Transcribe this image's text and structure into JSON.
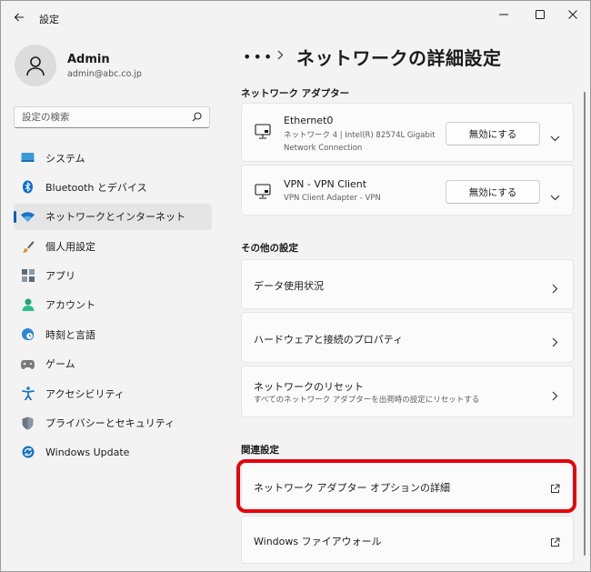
{
  "window": {
    "title": "設定"
  },
  "profile": {
    "name": "Admin",
    "email": "admin@abc.co.jp"
  },
  "search": {
    "placeholder": "設定の検索"
  },
  "sidebar": {
    "items": [
      {
        "label": "システム",
        "icon": "monitor-icon"
      },
      {
        "label": "Bluetooth とデバイス",
        "icon": "bluetooth-icon"
      },
      {
        "label": "ネットワークとインターネット",
        "icon": "wifi-icon",
        "active": true
      },
      {
        "label": "個人用設定",
        "icon": "brush-icon"
      },
      {
        "label": "アプリ",
        "icon": "apps-icon"
      },
      {
        "label": "アカウント",
        "icon": "person-icon"
      },
      {
        "label": "時刻と言語",
        "icon": "clock-globe-icon"
      },
      {
        "label": "ゲーム",
        "icon": "gamepad-icon"
      },
      {
        "label": "アクセシビリティ",
        "icon": "accessibility-icon"
      },
      {
        "label": "プライバシーとセキュリティ",
        "icon": "shield-icon"
      },
      {
        "label": "Windows Update",
        "icon": "update-icon"
      }
    ]
  },
  "main": {
    "breadcrumb_dots": "•••",
    "title": "ネットワークの詳細設定",
    "adapters_section": "ネットワーク アダプター",
    "adapters": [
      {
        "name": "Ethernet0",
        "desc": "ネットワーク 4 | Intel(R) 82574L Gigabit Network Connection",
        "button": "無効にする"
      },
      {
        "name": "VPN - VPN Client",
        "desc": "VPN Client Adapter - VPN",
        "button": "無効にする"
      }
    ],
    "other_section": "その他の設定",
    "other": [
      {
        "label": "データ使用状況",
        "sub": ""
      },
      {
        "label": "ハードウェアと接続のプロパティ",
        "sub": ""
      },
      {
        "label": "ネットワークのリセット",
        "sub": "すべてのネットワーク アダプターを出荷時の設定にリセットする"
      }
    ],
    "related_section": "関連設定",
    "related": [
      {
        "label": "ネットワーク アダプター オプションの詳細"
      },
      {
        "label": "Windows ファイアウォール"
      }
    ]
  },
  "colors": {
    "accent": "#005fb8",
    "highlight": "#e8000b"
  }
}
